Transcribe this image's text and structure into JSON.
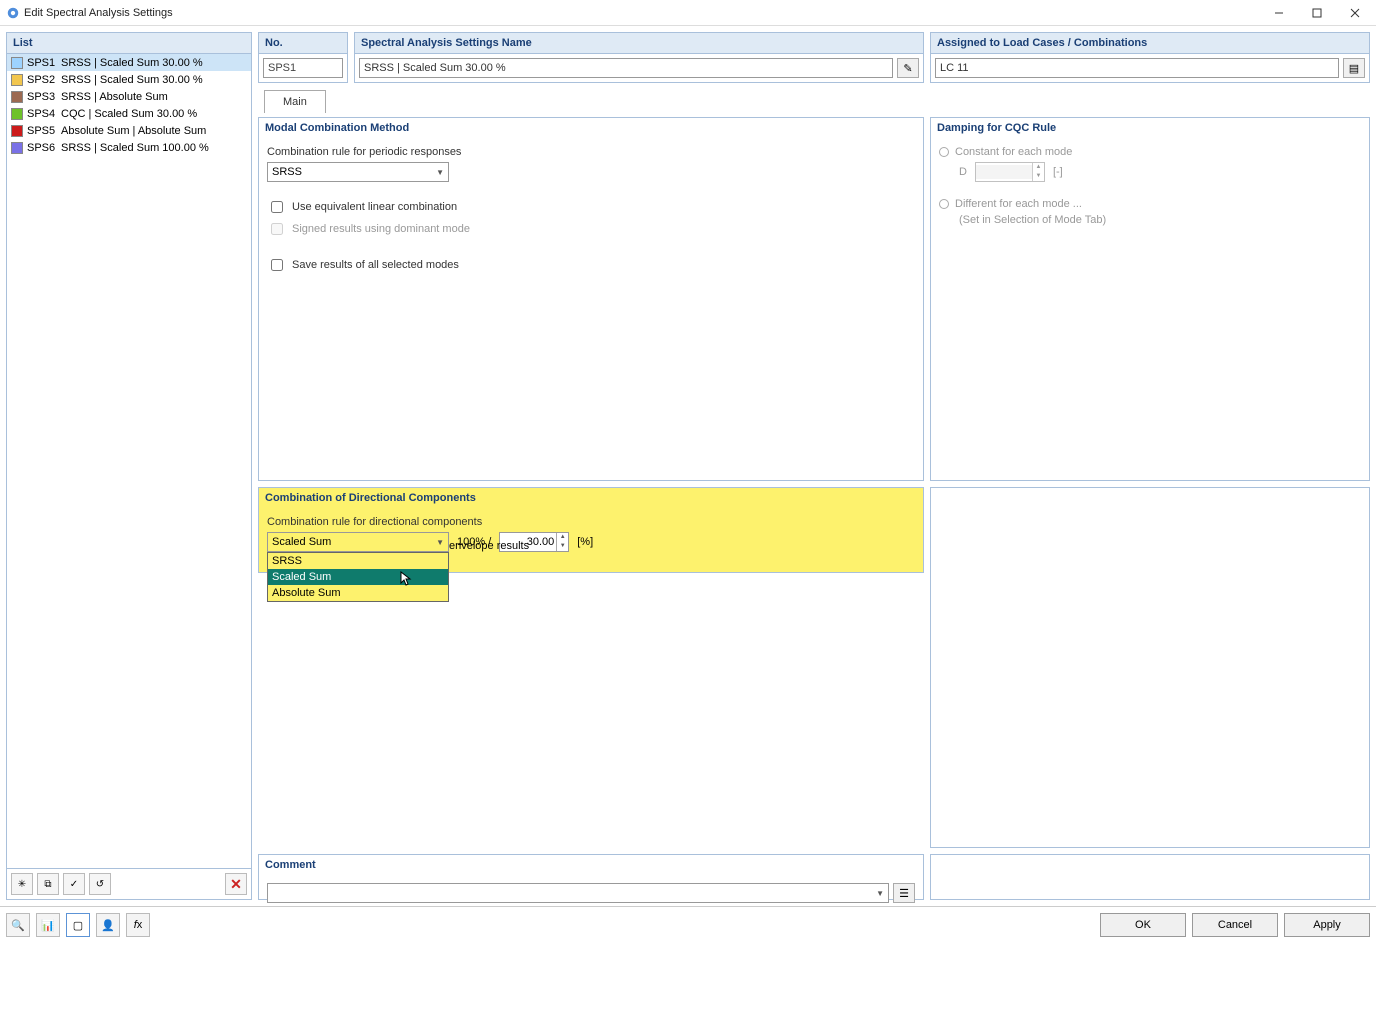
{
  "window": {
    "title": "Edit Spectral Analysis Settings"
  },
  "list": {
    "header": "List",
    "items": [
      {
        "id": "SPS1",
        "name": "SRSS | Scaled Sum 30.00 %",
        "color": "#9dd3ff",
        "selected": true
      },
      {
        "id": "SPS2",
        "name": "SRSS | Scaled Sum 30.00 %",
        "color": "#f2c64e"
      },
      {
        "id": "SPS3",
        "name": "SRSS | Absolute Sum",
        "color": "#9c6a52"
      },
      {
        "id": "SPS4",
        "name": "CQC | Scaled Sum 30.00 %",
        "color": "#6ec22a"
      },
      {
        "id": "SPS5",
        "name": "Absolute Sum | Absolute Sum",
        "color": "#cc1b1b"
      },
      {
        "id": "SPS6",
        "name": "SRSS | Scaled Sum 100.00 %",
        "color": "#7a71e6"
      }
    ]
  },
  "fields": {
    "no_label": "No.",
    "no_value": "SPS1",
    "name_label": "Spectral Analysis Settings Name",
    "name_value": "SRSS | Scaled Sum 30.00 %",
    "assigned_label": "Assigned to Load Cases / Combinations",
    "assigned_value": "LC 11"
  },
  "tabs": {
    "main": "Main"
  },
  "modal_combination": {
    "title": "Modal Combination Method",
    "rule_label": "Combination rule for periodic responses",
    "rule_value": "SRSS",
    "use_eq": "Use equivalent linear combination",
    "signed": "Signed results using dominant mode",
    "save": "Save results of all selected modes"
  },
  "damping": {
    "title": "Damping for CQC Rule",
    "constant": "Constant for each mode",
    "d_label": "D",
    "d_unit": "[-]",
    "different": "Different for each mode ...",
    "different_note": "(Set in Selection of Mode Tab)"
  },
  "directional": {
    "title": "Combination of Directional Components",
    "rule_label": "Combination rule for directional components",
    "rule_value": "Scaled Sum",
    "pct_label": "100% /",
    "pct_value": "30.00",
    "pct_unit": "[%]",
    "envelope": "envelope results",
    "options": [
      "SRSS",
      "Scaled Sum",
      "Absolute Sum"
    ],
    "hover_index": 1
  },
  "comment": {
    "title": "Comment",
    "value": ""
  },
  "buttons": {
    "ok": "OK",
    "cancel": "Cancel",
    "apply": "Apply"
  }
}
